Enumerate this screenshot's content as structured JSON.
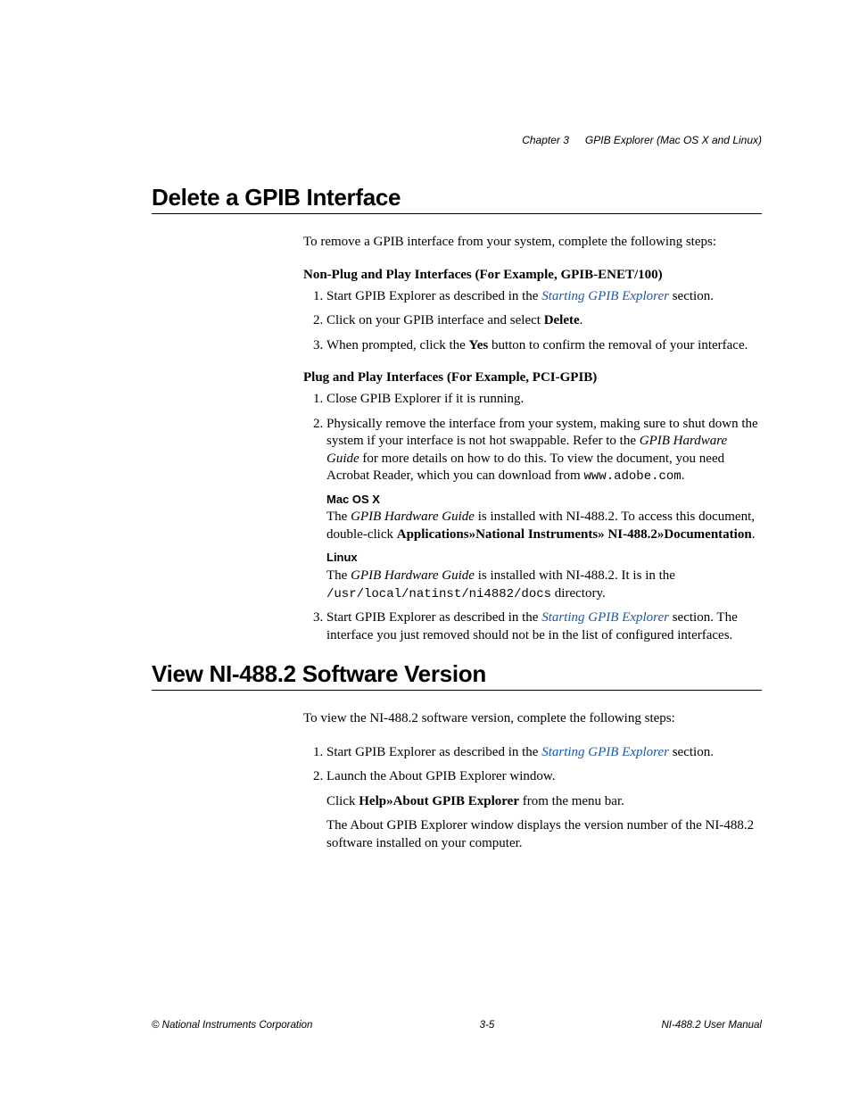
{
  "header": {
    "chapter": "Chapter 3",
    "title": "GPIB Explorer (Mac OS X and Linux)"
  },
  "section1": {
    "heading": "Delete a GPIB Interface",
    "intro": "To remove a GPIB interface from your system, complete the following steps:",
    "sub1": {
      "heading": "Non-Plug and Play Interfaces (For Example, GPIB-ENET/100)",
      "step1_a": "Start GPIB Explorer as described in the ",
      "step1_link": "Starting GPIB Explorer",
      "step1_b": " section.",
      "step2_a": "Click on your GPIB interface and select ",
      "step2_bold": "Delete",
      "step2_b": ".",
      "step3_a": "When prompted, click the ",
      "step3_bold": "Yes",
      "step3_b": " button to confirm the removal of your interface."
    },
    "sub2": {
      "heading": "Plug and Play Interfaces (For Example, PCI-GPIB)",
      "step1": "Close GPIB Explorer if it is running.",
      "step2_a": "Physically remove the interface from your system, making sure to shut down the system if your interface is not hot swappable. Refer to the ",
      "step2_i": "GPIB Hardware Guide",
      "step2_b": " for more details on how to do this. To view the document, you need Acrobat Reader, which you can download from ",
      "step2_mono": "www.adobe.com",
      "step2_c": ".",
      "mac_heading": "Mac OS X",
      "mac_a": "The ",
      "mac_i": "GPIB Hardware Guide",
      "mac_b": " is installed with NI-488.2. To access this document, double-click ",
      "mac_bold": "Applications»National Instruments» NI-488.2»Documentation",
      "mac_c": ".",
      "linux_heading": "Linux",
      "linux_a": "The ",
      "linux_i": "GPIB Hardware Guide",
      "linux_b": " is installed with NI-488.2. It is in the ",
      "linux_mono": "/usr/local/natinst/ni4882/docs",
      "linux_c": " directory.",
      "step3_a": "Start GPIB Explorer as described in the ",
      "step3_link": "Starting GPIB Explorer",
      "step3_b": " section. The interface you just removed should not be in the list of configured interfaces."
    }
  },
  "section2": {
    "heading": "View NI-488.2 Software Version",
    "intro": "To view the NI-488.2 software version, complete the following steps:",
    "step1_a": "Start GPIB Explorer as described in the ",
    "step1_link": "Starting GPIB Explorer",
    "step1_b": " section.",
    "step2": "Launch the About GPIB Explorer window.",
    "step2p_a": "Click ",
    "step2p_bold": "Help»About GPIB Explorer",
    "step2p_b": " from the menu bar.",
    "step2q": "The About GPIB Explorer window displays the version number of the NI-488.2 software installed on your computer."
  },
  "footer": {
    "left": "© National Instruments Corporation",
    "center": "3-5",
    "right": "NI-488.2 User Manual"
  }
}
